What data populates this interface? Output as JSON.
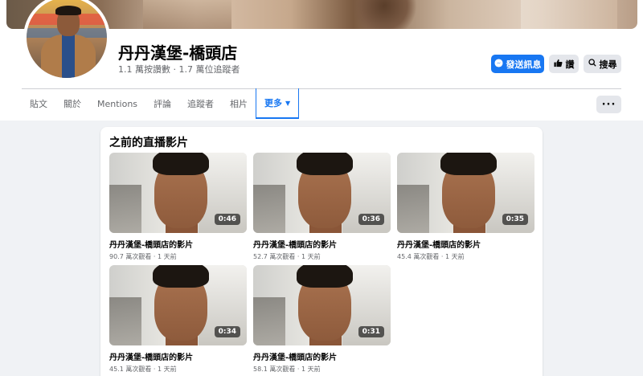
{
  "page": {
    "title": "丹丹漢堡-橋頭店",
    "stats": "1.1 萬按讚數 · 1.7 萬位追蹤者"
  },
  "actions": {
    "message_label": "發送訊息",
    "like_label": "讚",
    "search_label": "搜尋",
    "more_label": "···"
  },
  "tabs": [
    {
      "label": "貼文"
    },
    {
      "label": "關於"
    },
    {
      "label": "Mentions"
    },
    {
      "label": "評論"
    },
    {
      "label": "追蹤者"
    },
    {
      "label": "相片"
    },
    {
      "label": "更多",
      "active": true
    }
  ],
  "section": {
    "title": "之前的直播影片"
  },
  "videos": [
    {
      "title": "丹丹漢堡-橋頭店的影片",
      "duration": "0:46",
      "meta": "90.7 萬次觀看 · 1 天前"
    },
    {
      "title": "丹丹漢堡-橋頭店的影片",
      "duration": "0:36",
      "meta": "52.7 萬次觀看 · 1 天前"
    },
    {
      "title": "丹丹漢堡-橋頭店的影片",
      "duration": "0:35",
      "meta": "45.4 萬次觀看 · 1 天前"
    },
    {
      "title": "丹丹漢堡-橋頭店的影片",
      "duration": "0:34",
      "meta": "45.1 萬次觀看 · 1 天前"
    },
    {
      "title": "丹丹漢堡-橋頭店的影片",
      "duration": "0:31",
      "meta": "58.1 萬次觀看 · 1 天前"
    }
  ],
  "colors": {
    "primary": "#1877f2",
    "secondary_button": "#e4e6eb",
    "background": "#f0f2f5",
    "muted_text": "#65676b"
  },
  "icons": {
    "message": "messenger-icon",
    "like": "thumbs-up-icon",
    "search": "search-icon",
    "more": "ellipsis-icon",
    "tab_more": "caret-down-icon"
  }
}
